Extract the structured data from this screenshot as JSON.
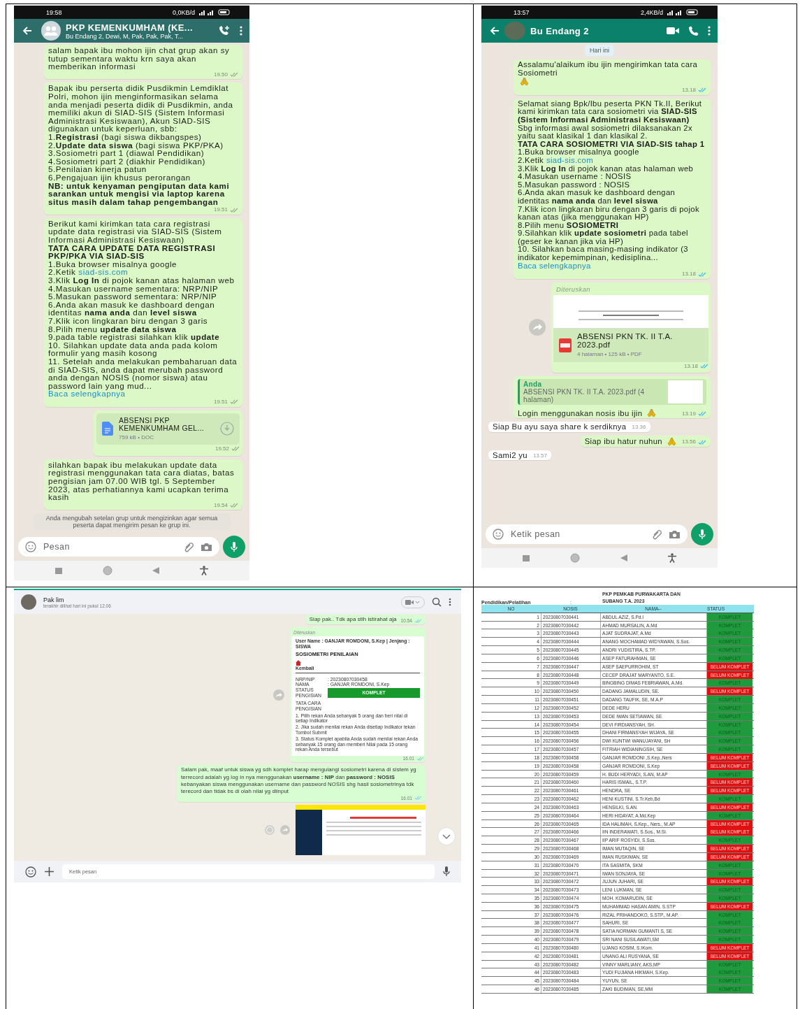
{
  "phones": [
    {
      "header": {
        "kind": "group",
        "title": "PKP KEMENKUMHAM (KE...",
        "subtitle": "Bu Endang 2, Dewi, M, Pak, Pak, Pak, T..."
      },
      "status_bar": {
        "time": "19:58",
        "data_rate": "0,0KB/d"
      },
      "messages": [
        {
          "kind": "text",
          "incoming": false,
          "read": false,
          "hands_emoji": false,
          "time": "19.50",
          "paragraphs": [
            "salam bapak ibu mohon ijin chat grup akan sy tutup sementara waktu krn saya akan memberikan informasi"
          ]
        },
        {
          "kind": "text",
          "incoming": false,
          "read": false,
          "hands_emoji": false,
          "time": "19.51",
          "paragraphs": [
            "Bapak ibu perserta didik Pusdikmin Lemdiklat Polri, mohon ijin menginformasikan selama anda menjadi peserta didik di Pusdikmin, anda memiliki akun di SIAD-SIS (Sistem Informasi Administrasi Kesiswaan), Akun SIAD-SIS digunakan untuk keperluan, sbb:",
            "1.**Registrasi** (bagi siswa dikbangspes)",
            "2.**Update data siswa** (bagi siswa PKP/PKA)",
            "3.Sosiometri part 1 (diawal Pendidikan)",
            "4.Sosiometri part 2 (diakhir Pendidikan)",
            "5.Penilaian kinerja patun",
            "6.Pengajuan ijin khusus perorangan",
            "**NB: untuk kenyaman pengiputan data kami sarankan untuk mengisi via laptop karena situs masih dalam tahap pengembangan**"
          ]
        },
        {
          "kind": "text",
          "incoming": false,
          "read": false,
          "hands_emoji": false,
          "time": "19.51",
          "paragraphs": [
            "Berikut kami kirimkan tata cara registrasi update data registrasi via SIAD-SIS (Sistem Informasi Administrasi Kesiswaan)",
            "**TATA CARA UPDATE DATA REGISTRASI PKP/PKA VIA SIAD-SIS**",
            "1.Buka browser misalnya google",
            {
              "text": "2.Ketik ",
              "link": "siad-sis.com"
            },
            "3.Klik **Log In** di pojok kanan atas halaman web",
            "4.Masukan username sementara: NRP/NIP",
            "5.Masukan password sementara: NRP/NIP",
            "6.Anda akan masuk ke dashboard dengan identitas **nama anda** dan **level siswa**",
            "7.Klik icon lingkaran biru dengan 3 garis",
            "8.Pilih menu **update data siswa**",
            "9.pada table registrasi silahkan klik **update**",
            "10.  Silahkan update data anda pada kolom formulir yang masih kosong",
            {
              "text": "11.  Setelah anda melakukan pembaharuan data di SIAD-SIS, anda dapat merubah password anda dengan NOSIS (nomor siswa) atau password lain yang mud... ",
              "read_more": "Baca selengkapnya"
            }
          ]
        },
        {
          "kind": "document",
          "incoming": false,
          "read": false,
          "time": "19.52",
          "title": "ABSENSI PKP KEMENKUMHAM GEL...",
          "meta": "759 kB • DOC"
        },
        {
          "kind": "text",
          "incoming": false,
          "read": false,
          "hands_emoji": false,
          "time": "19.54",
          "paragraphs": [
            "silahkan bapak ibu melakukan update data registrasi menggunakan tata cara diatas, batas pengisian jam 07.00 WIB tgl. 5 September 2023, atas perhatiannya kami ucapkan terima kasih"
          ]
        },
        {
          "kind": "notice",
          "text": "Anda mengubah setelan grup untuk mengizinkan agar semua peserta dapat mengirim pesan ke grup ini."
        }
      ],
      "composer": {
        "placeholder": "Pesan"
      }
    },
    {
      "header": {
        "kind": "contact",
        "title": "Bu Endang 2"
      },
      "status_bar": {
        "time": "13:57",
        "data_rate": "2,4KB/d"
      },
      "messages": [
        {
          "kind": "date",
          "text": "Hari ini"
        },
        {
          "kind": "text",
          "incoming": false,
          "read": true,
          "hands_emoji": true,
          "time": "13.18",
          "paragraphs": [
            "Assalamu'alaikum ibu ijin mengirimkan tata cara Sosiometri"
          ]
        },
        {
          "kind": "text",
          "incoming": false,
          "read": true,
          "hands_emoji": false,
          "time": "13.18",
          "paragraphs": [
            "Selamat siang Bpk/Ibu peserta PKN Tk.II, Berikut kami kirimkan tata cara sosiometri via **SIAD-SIS (Sistem Informasi Administrasi Kesiswaan)**",
            "Sbg informasi awal sosiometri dilaksanakan 2x yaitu saat klasikal 1 dan klasikal 2.",
            "**TATA CARA SOSIOMETRI VIA SIAD-SIS tahap 1**",
            "1.Buka browser misalnya google",
            {
              "text": "2.Ketik ",
              "link": "siad-sis.com"
            },
            "3.Klik **Log In** di pojok kanan atas halaman web",
            "4.Masukan username : NOSIS",
            "5.Masukan password : NOSIS",
            "6.Anda akan masuk ke dashboard dengan identitas **nama anda** dan **level siswa**",
            "7.Klik icon lingkaran biru dengan 3 garis di pojok kanan atas (jika menggunakan HP)",
            "8.Pilih menu **SOSIOMETRI**",
            "9.Silahkan klik **update sosiometri** pada tabel (geser ke kanan jika via HP)",
            {
              "text": "10.  Silahkan baca masing-masing indikator (3 indikator kepemimpinan, kedisiplina... ",
              "read_more": "Baca selengkapnya"
            }
          ]
        },
        {
          "kind": "forwarded_pdf",
          "incoming": false,
          "read": true,
          "time": "13.18",
          "forwarded_label": "Diteruskan",
          "title": "ABSENSI PKN TK. II T.A. 2023.pdf",
          "meta": "4 halaman • 125 kB • PDF"
        },
        {
          "kind": "quoted",
          "incoming": false,
          "read": true,
          "hands_emoji": true,
          "time": "13.19",
          "quote_author": "Anda",
          "quote_text": "ABSENSI PKN TK. II T.A. 2023.pdf (4 halaman)",
          "paragraphs": [
            "Login menggunakan nosis ibu ijin"
          ]
        },
        {
          "kind": "text",
          "incoming": true,
          "hands_emoji": false,
          "time": "13.36",
          "paragraphs": [
            "Siap Bu ayu saya share k serdiknya"
          ]
        },
        {
          "kind": "text",
          "incoming": false,
          "read": true,
          "hands_emoji": true,
          "time": "13.56",
          "paragraphs": [
            "Siap ibu hatur nuhun"
          ]
        },
        {
          "kind": "text",
          "incoming": true,
          "hands_emoji": false,
          "time": "13.57",
          "paragraphs": [
            "Sami2 yu"
          ]
        }
      ],
      "composer": {
        "placeholder": "Ketik pesan"
      }
    }
  ],
  "desktop_chat": {
    "contact": "Pak lim",
    "last_seen": "terakhir dilihat hari ini pukul 12.06",
    "messages": [
      {
        "kind": "text",
        "read": true,
        "time": "10.54",
        "text": "Siap pak.. Tdk apa stlh istirahat aja"
      },
      {
        "kind": "forwarded_screenshot",
        "read": true,
        "time": "16.01",
        "forwarded_label": "Diteruskan",
        "user_line": "User Name : GANJAR ROMDONI, S.Kep | Jenjang : SISWA",
        "page_title": "SOSIOMETRI PENILAIAN",
        "back_label": "Kembali",
        "fields": [
          {
            "label": "NRP/NIP",
            "value": ": 20230807030458"
          },
          {
            "label": "NAMA",
            "value": ": GANJAR ROMDONI, S.Kep"
          }
        ],
        "status_label": "STATUS PENGISIAN",
        "status_value": "KOMPLET",
        "instructions_label": "TATA CARA PENGISIAN",
        "instructions": [
          "1. Pilih rekan Anda sebanyak 5 orang dan beri nilai di setiap Indikator",
          "2. Jika sudah menilai rekan Anda disetiap Indikator tekan Tombol Submit",
          "3. Status Komplet apabila Anda sudah menilai rekan Anda sebanyak 15 orang dan memberi Nilai pada 15 orang rekan Anda tersebut"
        ]
      },
      {
        "kind": "text",
        "read": true,
        "time": "16.01",
        "text": "Salam pak, maaf untuk siswa yg sdh komplet harap mengulangi sosiometri karena di sistem yg terrecord adalah yg log in nya menggunakan **username : NIP** dan **password : NOSIS** kebanyakan siswa menggunakan username dan password NOSIS shg hasil sosiometrinya tdk terecord dan tidak bs di olah nilai yg diinput"
      },
      {
        "kind": "image"
      }
    ],
    "composer": {
      "placeholder": "Ketik pesan"
    }
  },
  "report_table": {
    "title_lines": [
      "PKP PEMKAB PURWAKARTA DAN",
      "SUBANG T.A. 2023"
    ],
    "label": "Pendidikan/Pelatihan",
    "separator": ":",
    "columns": [
      "NO",
      "NOSIS",
      "NAMA--",
      "STATUS"
    ],
    "rows": [
      {
        "no": "1",
        "nosis": "20230807030441",
        "name": "ABDUL AZIZ, S.Pd.I",
        "status": "KOMPLET",
        "complete": true
      },
      {
        "no": "2",
        "nosis": "20230807030442",
        "name": "AHMAD MURSALIN, A.Md",
        "status": "KOMPLET",
        "complete": true
      },
      {
        "no": "3",
        "nosis": "20230807030443",
        "name": "AJAT SUDRAJAT, A.Md",
        "status": "KOMPLET",
        "complete": true
      },
      {
        "no": "4",
        "nosis": "20230807030444",
        "name": "ANANG MOCHAMAD WIDYAWAN, S.Sos.",
        "status": "KOMPLET",
        "complete": true
      },
      {
        "no": "5",
        "nosis": "20230807030445",
        "name": "ANDRI YUDISTIRA, S.TP.",
        "status": "KOMPLET",
        "complete": true
      },
      {
        "no": "6",
        "nosis": "20230807030446",
        "name": "ASEP FATURAHMAN, SE",
        "status": "KOMPLET",
        "complete": true
      },
      {
        "no": "7",
        "nosis": "20230807030447",
        "name": "ASEP SAEPURROHIM, ST",
        "status": "BELUM KOMPLET",
        "complete": false
      },
      {
        "no": "8",
        "nosis": "20230807030448",
        "name": "CECEP DRAJAT MARYANTO, S.E.",
        "status": "BELUM KOMPLET",
        "complete": false
      },
      {
        "no": "9",
        "nosis": "20230807030449",
        "name": "BINGBING DIMAS FEBRIAWAN, A.Md.",
        "status": "KOMPLET",
        "complete": true
      },
      {
        "no": "10",
        "nosis": "20230807030450",
        "name": "DADANG JAMALUDIN, SE.",
        "status": "BELUM KOMPLET",
        "complete": false
      },
      {
        "no": "11",
        "nosis": "20230807030451",
        "name": "DADANG TAUFIK, SE, M.A.P",
        "status": "KOMPLET",
        "complete": true
      },
      {
        "no": "12",
        "nosis": "20230807030452",
        "name": "DEDE HERU",
        "status": "KOMPLET",
        "complete": true
      },
      {
        "no": "13",
        "nosis": "20230807030453",
        "name": "DEDE IWAN SETIAWAN, SE",
        "status": "KOMPLET",
        "complete": true
      },
      {
        "no": "14",
        "nosis": "20230807030454",
        "name": "DEVI FIRDIANSYAH, SH.",
        "status": "KOMPLET",
        "complete": true
      },
      {
        "no": "15",
        "nosis": "20230807030455",
        "name": "DHANI FIRMANSYAH WIJAYA, SE",
        "status": "KOMPLET",
        "complete": true
      },
      {
        "no": "16",
        "nosis": "20230807030456",
        "name": "DWI KUNTWI WANUJAYANI, SH",
        "status": "KOMPLET",
        "complete": true
      },
      {
        "no": "17",
        "nosis": "20230807030457",
        "name": "FITRIAH WIDIANINGSIH, SE",
        "status": "KOMPLET",
        "complete": true
      },
      {
        "no": "18",
        "nosis": "20230807030458",
        "name": "GANJAR ROMDONI ,S.Kep.,Ners",
        "status": "BELUM KOMPLET",
        "complete": false
      },
      {
        "no": "19",
        "nosis": "20230807030458",
        "name": "GANJAR ROMDONI, S.Kep",
        "status": "BELUM KOMPLET",
        "complete": false
      },
      {
        "no": "20",
        "nosis": "20230807030459",
        "name": "H. BUDI HERYADI, S.AN, M.AP",
        "status": "KOMPLET",
        "complete": true
      },
      {
        "no": "21",
        "nosis": "20230807030460",
        "name": "HARIS ISMAIL, S.T.P.",
        "status": "BELUM KOMPLET",
        "complete": false
      },
      {
        "no": "22",
        "nosis": "20230807030461",
        "name": "HENDRA, SE",
        "status": "BELUM KOMPLET",
        "complete": false
      },
      {
        "no": "23",
        "nosis": "20230807030462",
        "name": "HENI KUSTINI, S.Tr.Keb,Bd",
        "status": "KOMPLET",
        "complete": true
      },
      {
        "no": "24",
        "nosis": "20230807030463",
        "name": "HENSILKI, S.AN.",
        "status": "BELUM KOMPLET",
        "complete": false
      },
      {
        "no": "25",
        "nosis": "20230807030464",
        "name": "HERI HIDAYAT, A.Md.Kep",
        "status": "KOMPLET",
        "complete": true
      },
      {
        "no": "26",
        "nosis": "20230807030465",
        "name": "IDA HALIMAH, S.Kep., Ners., M.AP",
        "status": "BELUM KOMPLET",
        "complete": false
      },
      {
        "no": "27",
        "nosis": "20230807030466",
        "name": "IIN INDERAWATI, S.Sos., M.Si.",
        "status": "BELUM KOMPLET",
        "complete": false
      },
      {
        "no": "28",
        "nosis": "20230807030467",
        "name": "IIP ARIF ROSYIDI, S.Sos.",
        "status": "KOMPLET",
        "complete": true
      },
      {
        "no": "29",
        "nosis": "20230807030468",
        "name": "IMAN MUTAQIN, SE",
        "status": "BELUM KOMPLET",
        "complete": false
      },
      {
        "no": "30",
        "nosis": "20230807030469",
        "name": "IMAN RUSKIMAN, SE",
        "status": "BELUM KOMPLET",
        "complete": false
      },
      {
        "no": "31",
        "nosis": "20230807030470",
        "name": "ITA SASMITA, SKM",
        "status": "KOMPLET",
        "complete": true
      },
      {
        "no": "32",
        "nosis": "20230807030471",
        "name": "IWAN SONJAYA, SE",
        "status": "KOMPLET",
        "complete": true
      },
      {
        "no": "33",
        "nosis": "20230807030472",
        "name": "JUJUN JUHARI, SE",
        "status": "BELUM KOMPLET",
        "complete": false
      },
      {
        "no": "34",
        "nosis": "20230807030473",
        "name": "LENI LUKMAN, SE",
        "status": "KOMPLET",
        "complete": true
      },
      {
        "no": "35",
        "nosis": "20230807030474",
        "name": "MOH. KOMARUDIN, SE",
        "status": "KOMPLET",
        "complete": true
      },
      {
        "no": "36",
        "nosis": "20230807030475",
        "name": "MUHAMMAD HASAN AMIN, S.STP",
        "status": "BELUM KOMPLET",
        "complete": false
      },
      {
        "no": "37",
        "nosis": "20230807030476",
        "name": "RIZAL PRIHANDOKO, S.STP., M.AP.",
        "status": "KOMPLET",
        "complete": true
      },
      {
        "no": "38",
        "nosis": "20230807030477",
        "name": "SAHURI, SE",
        "status": "KOMPLET",
        "complete": true
      },
      {
        "no": "39",
        "nosis": "20230807030478",
        "name": "SATIA NORMAN GUMANTI S, SE",
        "status": "KOMPLET",
        "complete": true
      },
      {
        "no": "40",
        "nosis": "20230807030479",
        "name": "SRI NANI SUSILAWATI,SM",
        "status": "KOMPLET",
        "complete": true
      },
      {
        "no": "41",
        "nosis": "20230807030480",
        "name": "UJANG KOSIM, S.IKom.",
        "status": "BELUM KOMPLET",
        "complete": false
      },
      {
        "no": "42",
        "nosis": "20230807030481",
        "name": "UNANG ALI RUSYANA, SE",
        "status": "BELUM KOMPLET",
        "complete": false
      },
      {
        "no": "43",
        "nosis": "20230807030482",
        "name": "VINNY MARLIANY, AKS,MP",
        "status": "KOMPLET",
        "complete": true
      },
      {
        "no": "44",
        "nosis": "20230807030483",
        "name": "YUDI FUJIANA HIKMAH, S.Kep.",
        "status": "KOMPLET",
        "complete": true
      },
      {
        "no": "45",
        "nosis": "20230807030484",
        "name": "YUYUN, SE",
        "status": "KOMPLET",
        "complete": true
      },
      {
        "no": "46",
        "nosis": "20230807030485",
        "name": "ZAKI BUDIMAN, SE,MM",
        "status": "KOMPLET",
        "complete": true
      }
    ]
  }
}
